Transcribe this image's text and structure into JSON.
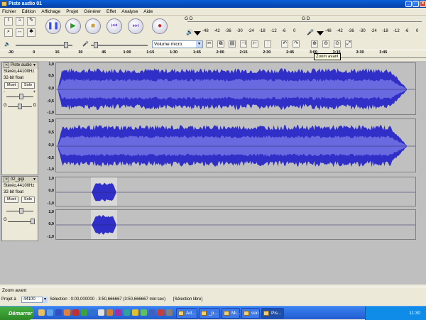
{
  "window": {
    "title": "Piste audio 01",
    "buttons": [
      "_",
      "□",
      "x"
    ]
  },
  "menu": [
    "Fichier",
    "Edition",
    "Affichage",
    "Projet",
    "Générer",
    "Effet",
    "Analyse",
    "Aide"
  ],
  "meters": {
    "playback_label": "G D",
    "record_label": "G D",
    "scale": [
      "-48",
      "-42",
      "-36",
      "-30",
      "-24",
      "-18",
      "-12",
      "-6",
      "0"
    ]
  },
  "mixer": {
    "input_source": "Volume micro"
  },
  "ruler": {
    "ticks": [
      "-30",
      "0",
      "15",
      "30",
      "45",
      "1:00",
      "1:15",
      "1:30",
      "1:45",
      "2:00",
      "2:15",
      "2:30",
      "2:45",
      "3:00",
      "3:15",
      "3:30",
      "3:45"
    ]
  },
  "tooltip": "Zoom avant",
  "tracks": [
    {
      "name": "Piste audio",
      "format": "Stéréo,44100Hz",
      "bits": "32-bit float",
      "mute": "Muet",
      "solo": "Solo",
      "pan_left": "G",
      "pan_right": "D",
      "gain_minus": "-",
      "gain_plus": "+",
      "axis": [
        "1,0",
        "0,5",
        "0,0",
        "-0,5",
        "-1,0"
      ]
    },
    {
      "name": "02_gigi",
      "format": "Stéréo,44100Hz",
      "bits": "32-bit float",
      "mute": "Muet",
      "solo": "Solo",
      "pan_left": "G",
      "axis": [
        "1,0",
        "0,0",
        "-1,0"
      ]
    }
  ],
  "status": {
    "message": "Zoom avant"
  },
  "project": {
    "rate_label": "Projet à",
    "rate": "44100",
    "selection": "Sélection : 0:00,000000 - 3:50,666667 (3:50,666667 min:sec)",
    "mode": "[Sélection libre]"
  },
  "taskbar": {
    "start": "Démarrer",
    "items": [
      "Ad...",
      "_p...",
      "Mi...",
      "",
      "son",
      "Pis..."
    ],
    "clock": "11:30"
  },
  "colors": {
    "waveform": "#3030c8",
    "waveform_light": "#6a6ae0",
    "titlebar": "#0a5fd8",
    "track_bg": "#c0c0c0"
  }
}
